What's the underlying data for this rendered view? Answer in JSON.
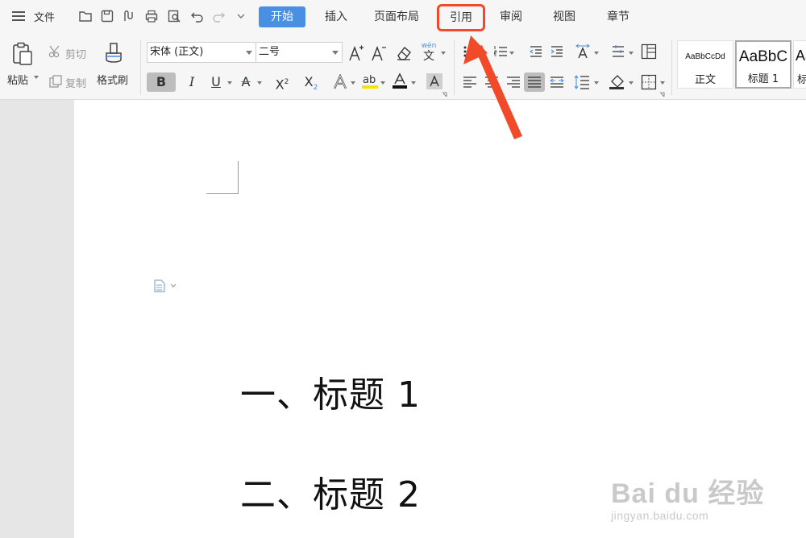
{
  "menubar": {
    "file_label": "文件",
    "tabs": [
      "开始",
      "插入",
      "页面布局",
      "引用",
      "审阅",
      "视图",
      "章节"
    ],
    "active_tab": "开始",
    "highlighted_tab": "引用",
    "accent_color": "#4a90e2",
    "highlight_color": "#f04a2a"
  },
  "ribbon": {
    "paste_label": "粘贴",
    "cut_label": "剪切",
    "copy_label": "复制",
    "format_painter_label": "格式刷",
    "font_name": "宋体 (正文)",
    "font_size": "二号",
    "wen_label": "wén",
    "phonetic_char": "文",
    "bold": "B",
    "italic": "I",
    "underline": "U",
    "strike": "A",
    "superscript": "X",
    "subscript": "X",
    "sup_mark": "2",
    "sub_mark": "2",
    "styles": [
      {
        "preview": "AaBbCcDd",
        "name": "正文"
      },
      {
        "preview": "AaBbC",
        "name": "标题 1"
      },
      {
        "preview": "Aa",
        "name": "标"
      }
    ]
  },
  "document": {
    "heading1": "一、标题 1",
    "heading2": "二、标题 2"
  },
  "watermark": {
    "main": "Bai du 经验",
    "sub": "jingyan.baidu.com"
  }
}
